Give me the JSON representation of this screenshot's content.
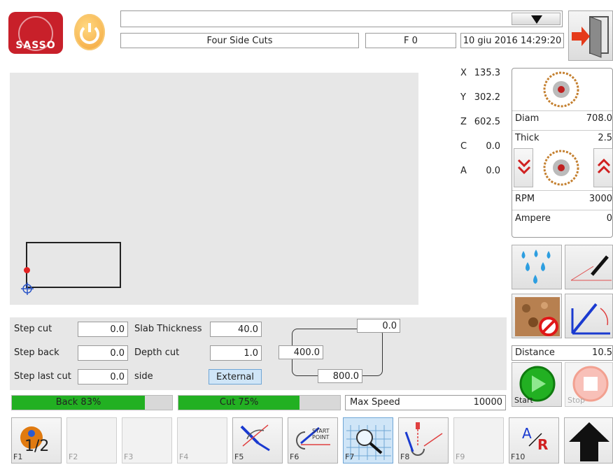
{
  "header": {
    "brand": "SASSO",
    "program": "Four Side Cuts",
    "f_value": "F 0",
    "datetime": "10 giu 2016 14:29:20",
    "dropdown_value": ""
  },
  "axes": [
    {
      "label": "X",
      "value": "135.3"
    },
    {
      "label": "Y",
      "value": "302.2"
    },
    {
      "label": "Z",
      "value": "602.5"
    },
    {
      "label": "C",
      "value": "0.0"
    },
    {
      "label": "A",
      "value": "0.0"
    }
  ],
  "blade": {
    "diam_label": "Diam",
    "diam_value": "708.0",
    "thick_label": "Thick",
    "thick_value": "2.5",
    "rpm_label": "RPM",
    "rpm_value": "3000",
    "ampere_label": "Ampere",
    "ampere_value": "0"
  },
  "distance": {
    "label": "Distance",
    "value": "10.5"
  },
  "params": {
    "step_cut_label": "Step cut",
    "step_cut": "0.0",
    "step_back_label": "Step back",
    "step_back": "0.0",
    "step_last_label": "Step last cut",
    "step_last": "0.0",
    "slab_label": "Slab Thickness",
    "slab": "40.0",
    "depth_label": "Depth cut",
    "depth": "1.0",
    "side_label": "side",
    "side": "External",
    "dim_top": "0.0",
    "dim_left": "400.0",
    "dim_bottom": "800.0"
  },
  "progress": {
    "back_label": "Back 83%",
    "back": 83,
    "cut_label": "Cut 75%",
    "cut": 75,
    "speed_label": "Max Speed",
    "speed": "10000"
  },
  "actions": {
    "start": "Start",
    "stop": "Stop"
  },
  "fkeys": [
    "F1",
    "F2",
    "F3",
    "F4",
    "F5",
    "F6",
    "F7",
    "F8",
    "F9",
    "F10"
  ],
  "f1_text": "1/2",
  "f6_text": "START POINT",
  "f10_a": "A",
  "f10_r": "R",
  "colors": {
    "green": "#22b022",
    "brand_red": "#c8202a",
    "accent_orange": "#e07a10"
  }
}
